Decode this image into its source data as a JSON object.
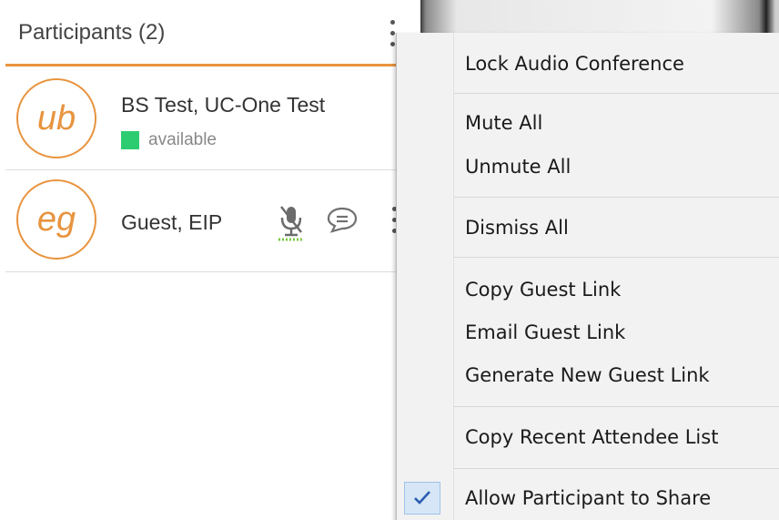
{
  "participants_panel": {
    "title": "Participants (2)",
    "participants": [
      {
        "initials": "ub",
        "name": "BS Test, UC-One Test",
        "presence": "available",
        "presence_color": "#2ecc71"
      },
      {
        "initials": "eg",
        "name": "Guest, EIP"
      }
    ],
    "accent_color": "#e8943f"
  },
  "context_menu": {
    "items": [
      "Lock Audio Conference",
      "Mute All",
      "Unmute All",
      "Dismiss All",
      "Copy Guest Link",
      "Email Guest Link",
      "Generate New Guest Link",
      "Copy Recent Attendee List",
      "Allow Participant to Share"
    ],
    "checked_item": "Allow Participant to Share",
    "check_icon": "checkmark-icon"
  }
}
